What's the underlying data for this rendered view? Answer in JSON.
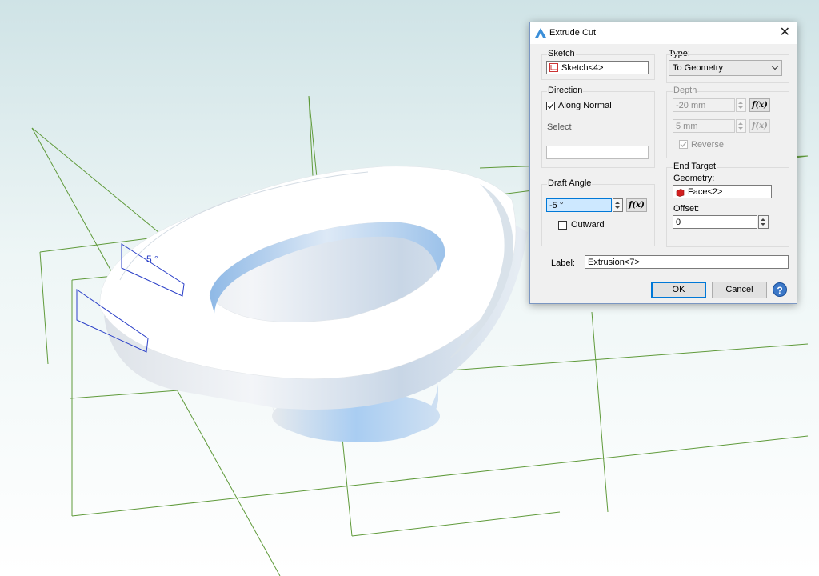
{
  "dialog": {
    "title": "Extrude Cut",
    "sketch": {
      "label": "Sketch",
      "value": "Sketch<4>"
    },
    "direction": {
      "label": "Direction",
      "along_normal": "Along Normal",
      "select": "Select",
      "select_value": ""
    },
    "draft_angle": {
      "label": "Draft Angle",
      "value": "-5 °",
      "outward": "Outward"
    },
    "type": {
      "label": "Type:",
      "value": "To Geometry"
    },
    "depth": {
      "label": "Depth",
      "value": "-20 mm",
      "value2": "5 mm",
      "reverse": "Reverse"
    },
    "end_target": {
      "label": "End Target",
      "geometry_label": "Geometry:",
      "geometry_value": "Face<2>",
      "offset_label": "Offset:",
      "offset_value": "0"
    },
    "name_label": "Label:",
    "name_value": "Extrusion<7>",
    "ok": "OK",
    "cancel": "Cancel",
    "help": "?",
    "fx": "f(x)"
  },
  "viewport": {
    "dimension_text": "5 °"
  }
}
